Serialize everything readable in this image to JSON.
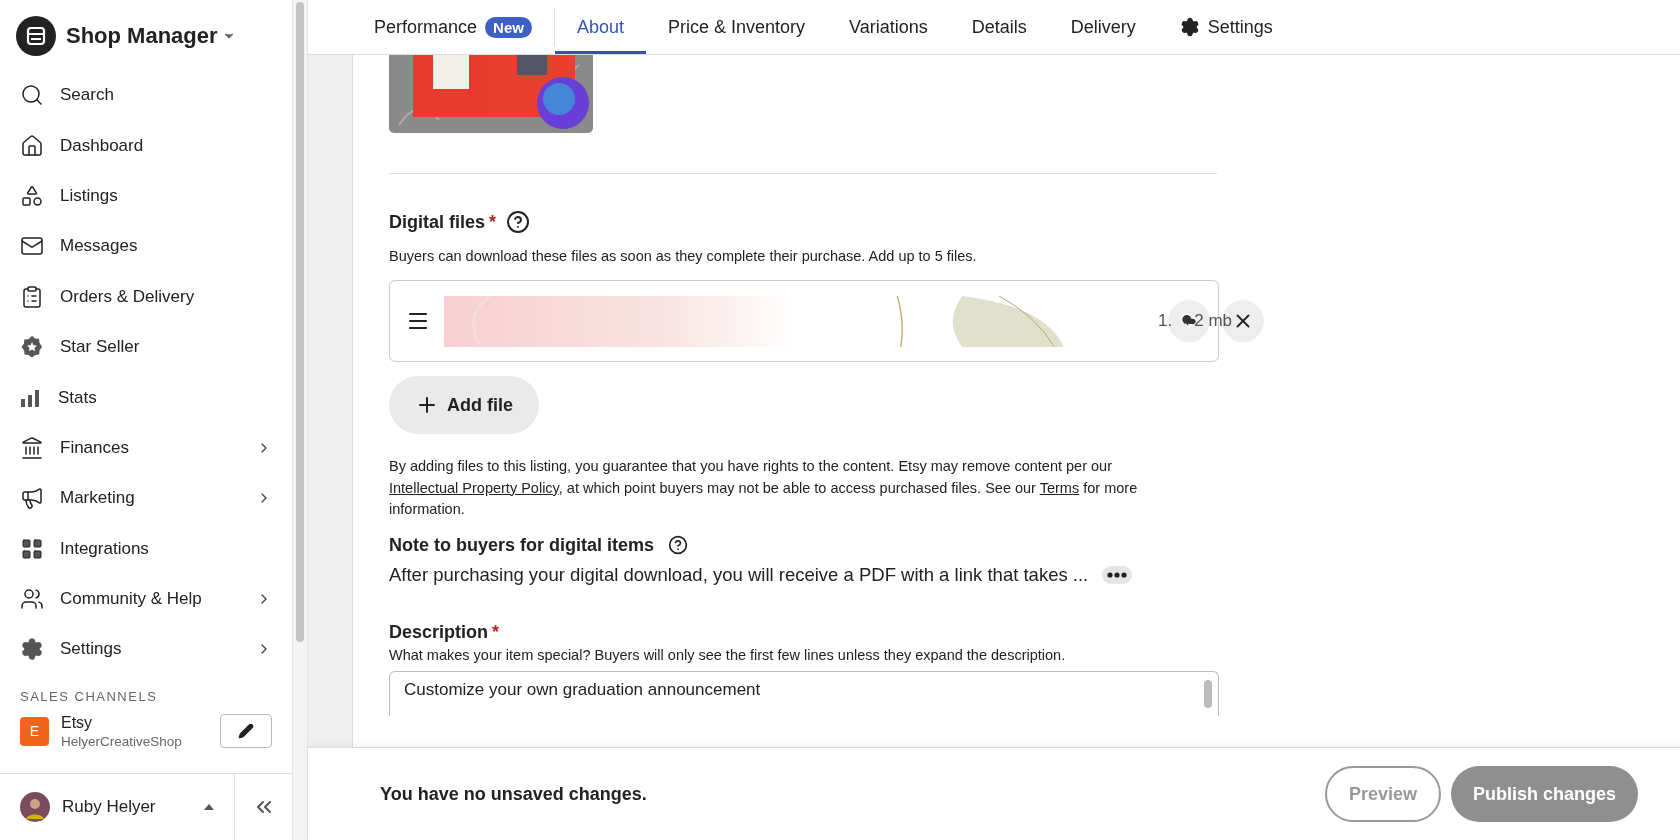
{
  "sidebar": {
    "title": "Shop Manager",
    "items": [
      {
        "label": "Search",
        "submenu": false
      },
      {
        "label": "Dashboard",
        "submenu": false
      },
      {
        "label": "Listings",
        "submenu": false
      },
      {
        "label": "Messages",
        "submenu": false
      },
      {
        "label": "Orders & Delivery",
        "submenu": false
      },
      {
        "label": "Star Seller",
        "submenu": false
      },
      {
        "label": "Stats",
        "submenu": false
      },
      {
        "label": "Finances",
        "submenu": true
      },
      {
        "label": "Marketing",
        "submenu": true
      },
      {
        "label": "Integrations",
        "submenu": false
      },
      {
        "label": "Community & Help",
        "submenu": true
      },
      {
        "label": "Settings",
        "submenu": true
      }
    ],
    "section_heading": "SALES CHANNELS",
    "channel": {
      "badge": "E",
      "name": "Etsy",
      "shop": "HelyerCreativeShop"
    },
    "user": {
      "name": "Ruby Helyer"
    }
  },
  "tabs": [
    {
      "label": "Performance",
      "badge": "New",
      "kind": "text",
      "selected": false
    },
    {
      "label": "About",
      "kind": "text",
      "selected": true
    },
    {
      "label": "Price & Inventory",
      "kind": "text",
      "selected": false
    },
    {
      "label": "Variations",
      "kind": "text",
      "selected": false
    },
    {
      "label": "Details",
      "kind": "text",
      "selected": false
    },
    {
      "label": "Delivery",
      "kind": "text",
      "selected": false
    },
    {
      "label": "Settings",
      "kind": "gear",
      "selected": false
    }
  ],
  "digital_files": {
    "title": "Digital files",
    "required_mark": "*",
    "hint": "Buyers can download these files as soon as they complete their purchase. Add up to 5 files.",
    "files": [
      {
        "size_start": "1.",
        "size_end": "2 mb"
      }
    ],
    "add_button": "Add file",
    "legal": [
      {
        "text": "By adding files to this listing, you guarantee that you have rights to the content. Etsy may remove content per our ",
        "kind": "text"
      },
      {
        "text": "Intellectual Property Policy",
        "kind": "link"
      },
      {
        "text": ", at which point buyers may not be able to access purchased files. See our ",
        "kind": "text"
      },
      {
        "text": "Terms",
        "kind": "link"
      },
      {
        "text": " for more information.",
        "kind": "text"
      }
    ]
  },
  "note": {
    "title": "Note to buyers for digital items",
    "value": "After purchasing your digital download, you will receive a PDF with a link that takes ..."
  },
  "description": {
    "title": "Description",
    "required_mark": "*",
    "hint": "What makes your item special? Buyers will only see the first few lines unless they expand the description.",
    "value": "Customize your own graduation announcement"
  },
  "footer": {
    "status": "You have no unsaved changes.",
    "preview": {
      "label": "Preview",
      "disabled": true
    },
    "publish": {
      "label": "Publish changes",
      "disabled": true
    }
  }
}
